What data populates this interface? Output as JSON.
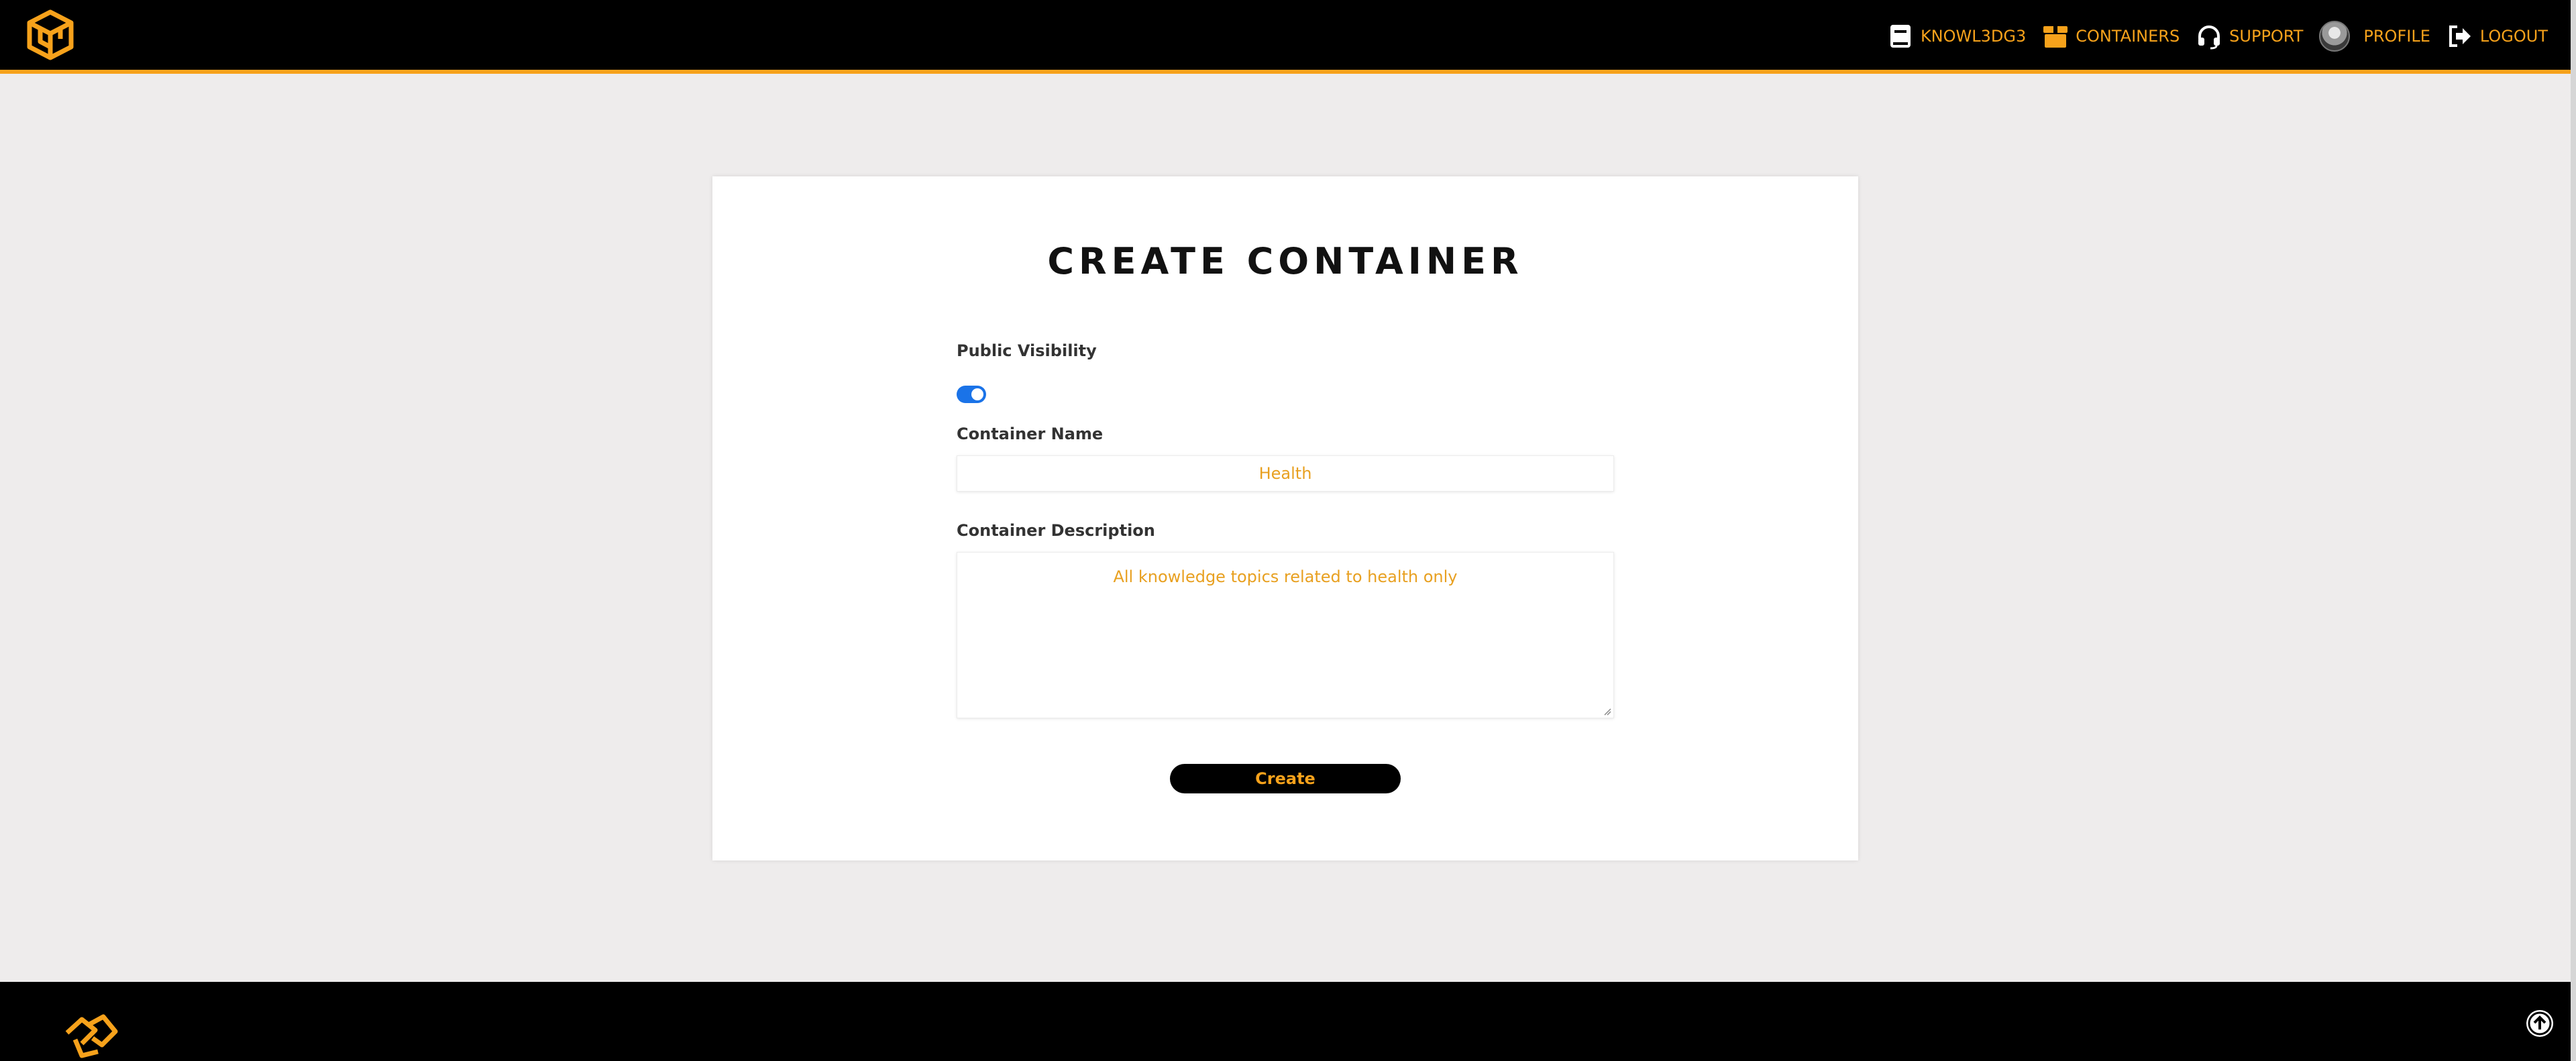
{
  "nav": {
    "items": [
      {
        "label": "KNOWL3DG3",
        "icon": "book-icon"
      },
      {
        "label": "CONTAINERS",
        "icon": "box-icon"
      },
      {
        "label": "SUPPORT",
        "icon": "headset-icon"
      },
      {
        "label": "PROFILE",
        "icon": "avatar"
      },
      {
        "label": "LOGOUT",
        "icon": "logout-icon"
      }
    ]
  },
  "form": {
    "title": "CREATE CONTAINER",
    "visibility_label": "Public Visibility",
    "visibility_on": true,
    "name_label": "Container Name",
    "name_value": "Health",
    "description_label": "Container Description",
    "description_value": "All knowledge topics related to health only",
    "submit_label": "Create"
  },
  "colors": {
    "accent": "#f7a21b",
    "toggle": "#1a73e8",
    "background": "#eeecec",
    "header": "#000000"
  }
}
